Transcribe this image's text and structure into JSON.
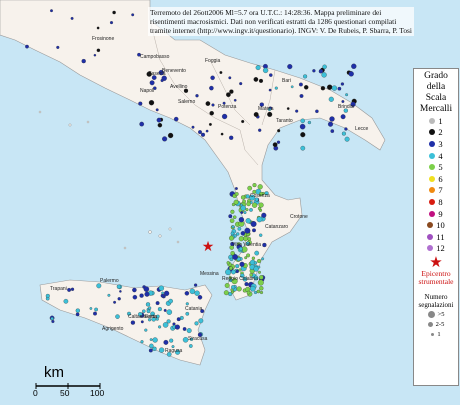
{
  "caption": {
    "text": "Terremoto del 26ott2006 Ml=5.7 ora U.T.C.: 14:28:36.  Mappa preliminare dei risentimenti macrosismici.  Dati non verificati estratti da 1286 questionari compilati tramite internet (http://www.ingv.it/questionario).  INGV: V. De Rubeis, P. Sbarra, P. Tosi"
  },
  "legend": {
    "title_line1": "Grado",
    "title_line2": "della",
    "title_line3": "Scala",
    "title_line4": "Mercalli",
    "grades": [
      {
        "label": "1",
        "color": "#bbbbbb"
      },
      {
        "label": "2",
        "color": "#111111"
      },
      {
        "label": "3",
        "color": "#1f2fa8"
      },
      {
        "label": "4",
        "color": "#3cc0d8"
      },
      {
        "label": "5",
        "color": "#7cd04a"
      },
      {
        "label": "6",
        "color": "#f0e020"
      },
      {
        "label": "7",
        "color": "#f08a10"
      },
      {
        "label": "8",
        "color": "#d81c10"
      },
      {
        "label": "9",
        "color": "#c01080"
      },
      {
        "label": "10",
        "color": "#8a4a20"
      },
      {
        "label": "11",
        "color": "#a050c0"
      },
      {
        "label": "12",
        "color": "#b070d0"
      }
    ],
    "epicenter_line1": "Epicentro",
    "epicenter_line2": "strumentale",
    "count_line1": "Numero",
    "count_line2": "segnalazioni",
    "count_classes": [
      ">5",
      "2-5",
      "1"
    ]
  },
  "scale_bar": {
    "unit": "km",
    "ticks": [
      "0",
      "50",
      "100"
    ]
  },
  "cities": [
    "Frosinone",
    "Campobasso",
    "Foggia",
    "Bari",
    "Caserta",
    "Benevento",
    "Napoli",
    "Avellino",
    "Potenza",
    "Matera",
    "Taranto",
    "Brindisi",
    "Salerno",
    "Lecce",
    "Cosenza",
    "Crotone",
    "Catanzaro",
    "Vibo Valentia",
    "Reggio Calabria",
    "Messina",
    "Palermo",
    "Trapani",
    "Agrigento",
    "Caltanissetta",
    "Enna",
    "Catania",
    "Siracusa",
    "Ragusa"
  ]
}
